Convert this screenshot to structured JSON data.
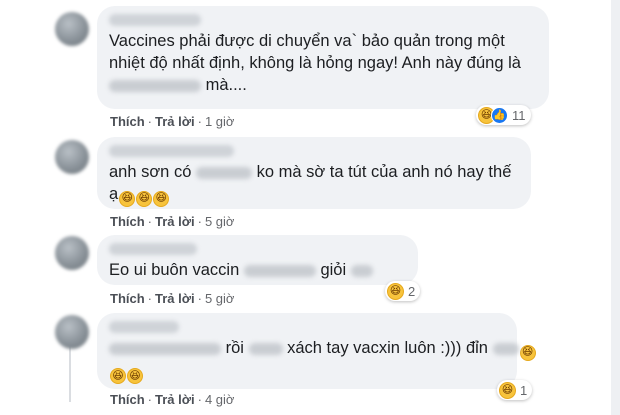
{
  "comments": [
    {
      "line1": "Vaccines phải được di chuyển va` bảo quản trong một",
      "line2": "nhiệt độ nhất định, không là hỏng ngay! Anh này đúng là",
      "line3_tail": "mà....",
      "actions": {
        "like": "Thích",
        "reply": "Trả lời",
        "time": "1 giờ"
      },
      "reactions": {
        "emojis": [
          "laugh-icon",
          "like-icon"
        ],
        "count": "11"
      }
    },
    {
      "line1_a": "anh sơn có",
      "line1_b": "ko mà sờ ta tút của anh nó hay thế",
      "line2": "ạ",
      "actions": {
        "like": "Thích",
        "reply": "Trả lời",
        "time": "5 giờ"
      }
    },
    {
      "line1_a": "Eo ui buôn vaccin",
      "line1_b": "giỏi",
      "actions": {
        "like": "Thích",
        "reply": "Trả lời",
        "time": "5 giờ"
      },
      "reactions": {
        "emojis": [
          "laugh-icon"
        ],
        "count": "2"
      }
    },
    {
      "line1_a": "rồi",
      "line1_b": "xách tay vacxin luôn :)))  đỉn",
      "actions": {
        "like": "Thích",
        "reply": "Trả lời",
        "time": "4 giờ"
      },
      "reactions": {
        "emojis": [
          "laugh-icon"
        ],
        "count": "1"
      }
    }
  ],
  "colors": {
    "bubble": "#f0f2f5",
    "meta": "#65676b",
    "reaction_like": "#1877f2",
    "reaction_laugh": "#f7c33c"
  }
}
